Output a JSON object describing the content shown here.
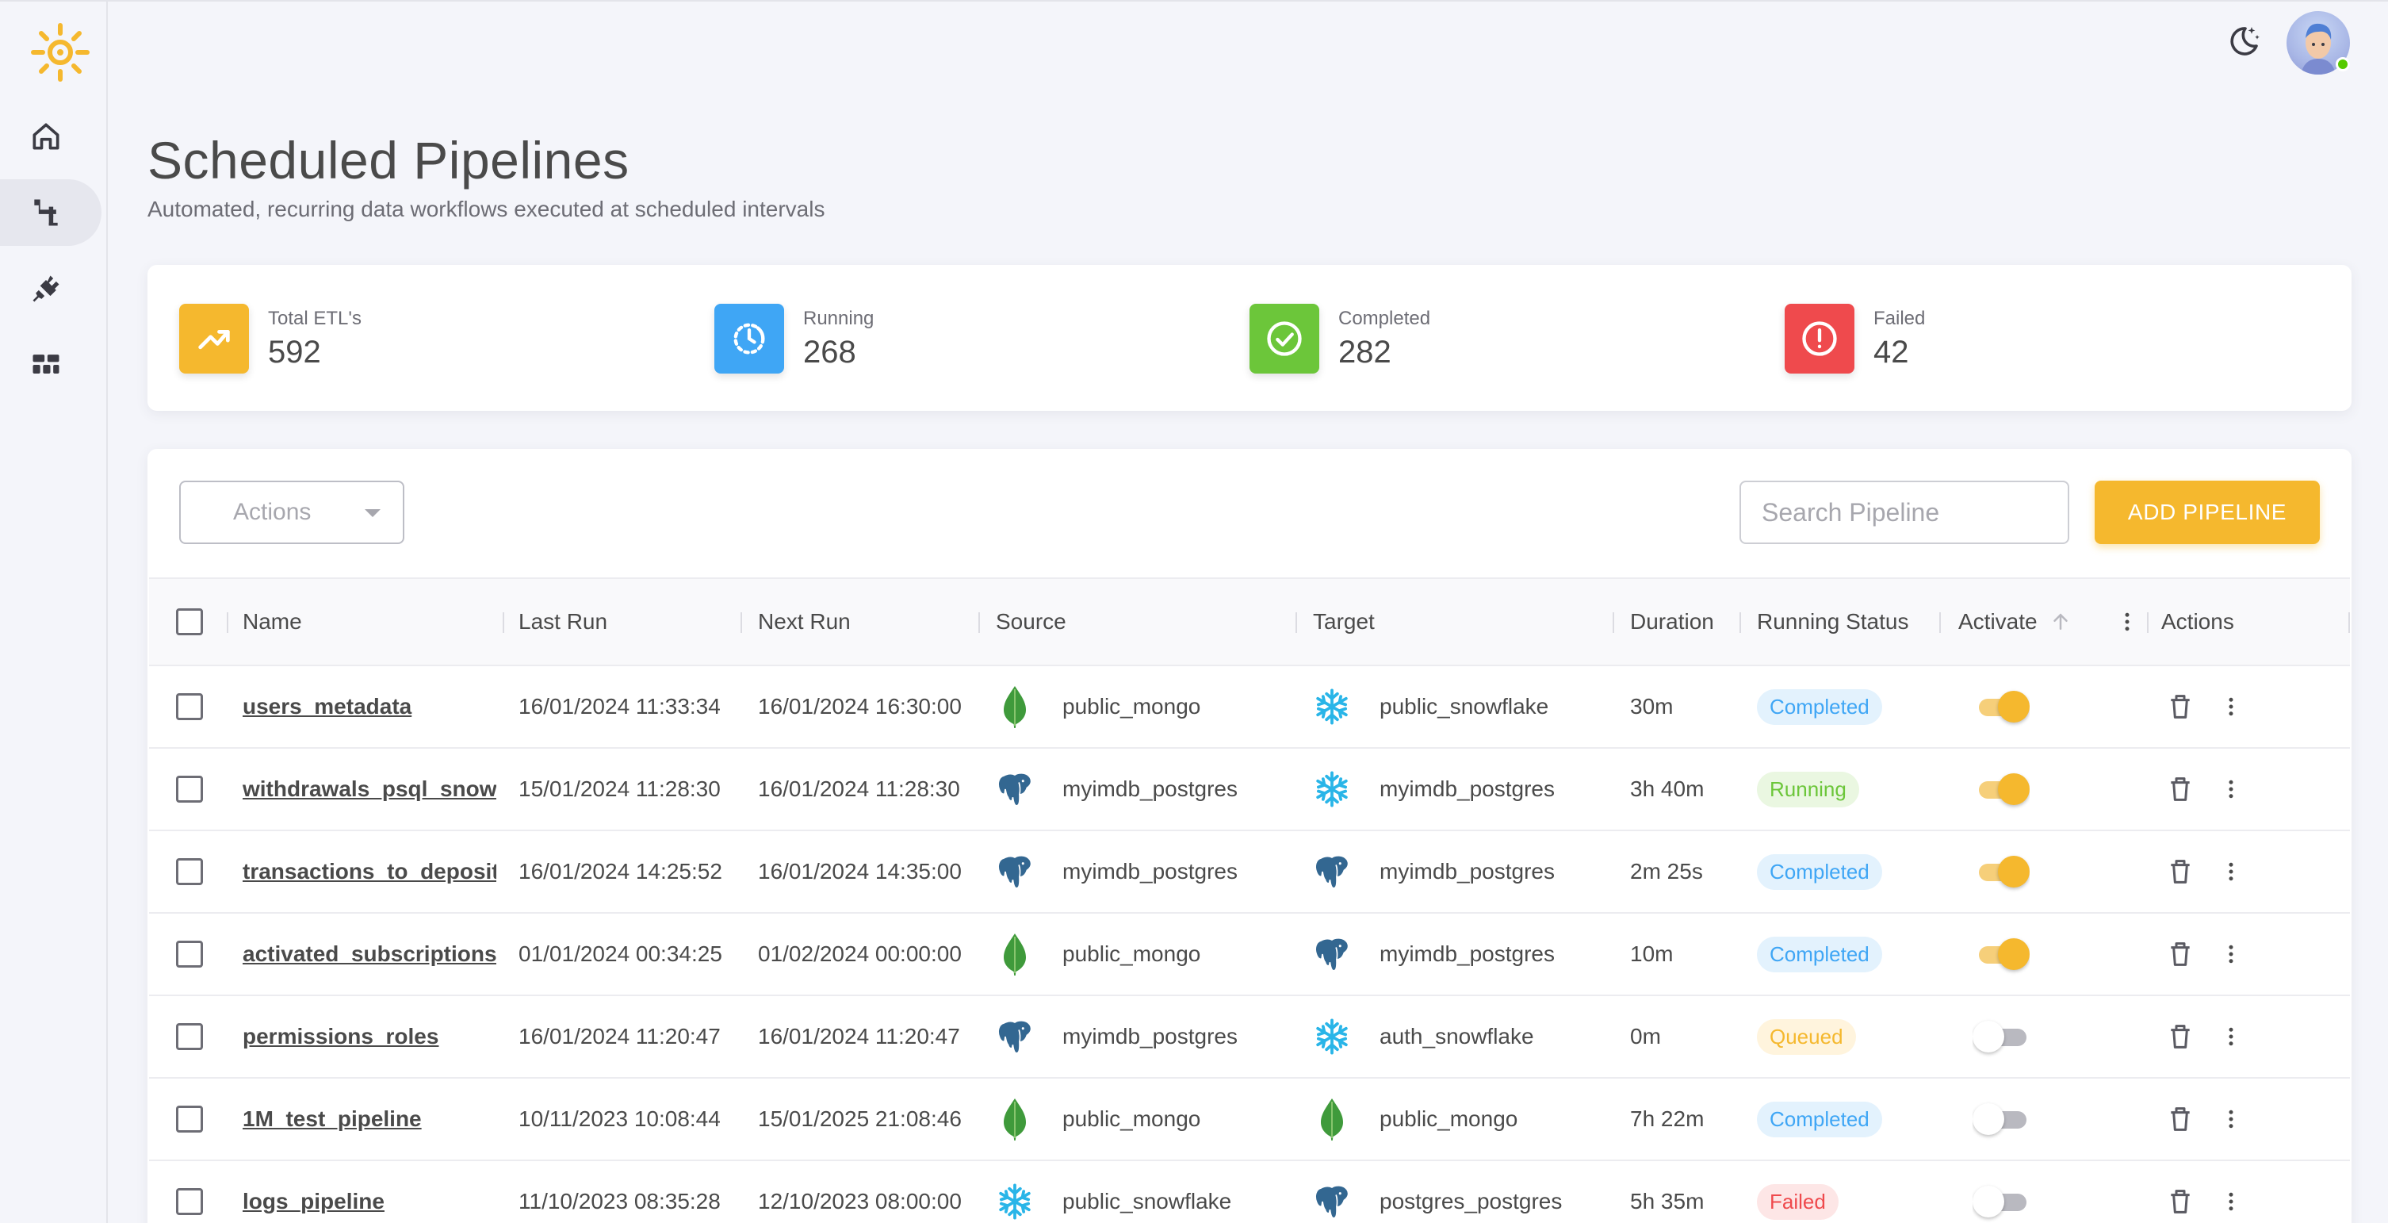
{
  "page": {
    "title": "Scheduled Pipelines",
    "subtitle": "Automated, recurring data workflows executed at scheduled intervals"
  },
  "sidebar": {
    "items": [
      {
        "name": "home",
        "icon": "home-icon"
      },
      {
        "name": "pipelines",
        "icon": "pipeline-icon",
        "active": true
      },
      {
        "name": "connections",
        "icon": "plug-icon"
      },
      {
        "name": "datasets",
        "icon": "blocks-icon"
      }
    ]
  },
  "stats": [
    {
      "label": "Total ETL's",
      "value": "592",
      "color": "#f5b82e",
      "icon": "trending-up-icon"
    },
    {
      "label": "Running",
      "value": "268",
      "color": "#3fa6f5",
      "icon": "clock-icon"
    },
    {
      "label": "Completed",
      "value": "282",
      "color": "#6cc63a",
      "icon": "check-circle-icon"
    },
    {
      "label": "Failed",
      "value": "42",
      "color": "#ef4a4d",
      "icon": "alert-circle-icon"
    }
  ],
  "toolbar": {
    "actions_label": "Actions",
    "search_placeholder": "Search Pipeline",
    "add_label": "ADD PIPELINE"
  },
  "table": {
    "columns": [
      "Name",
      "Last Run",
      "Next Run",
      "Source",
      "Target",
      "Duration",
      "Running Status",
      "Activate",
      "Actions"
    ],
    "rows": [
      {
        "name": "users_metadata",
        "last_run": "16/01/2024 11:33:34",
        "next_run": "16/01/2024 16:30:00",
        "source_type": "mongo",
        "source": "public_mongo",
        "target_type": "snowflake",
        "target": "public_snowflake",
        "duration": "30m",
        "status": "Completed",
        "active": true
      },
      {
        "name": "withdrawals_psql_snow",
        "last_run": "15/01/2024 11:28:30",
        "next_run": "16/01/2024 11:28:30",
        "source_type": "postgres",
        "source": "myimdb_postgres",
        "target_type": "snowflake",
        "target": "myimdb_postgres",
        "duration": "3h 40m",
        "status": "Running",
        "active": true
      },
      {
        "name": "transactions_to_deposit",
        "last_run": "16/01/2024 14:25:52",
        "next_run": "16/01/2024 14:35:00",
        "source_type": "postgres",
        "source": "myimdb_postgres",
        "target_type": "postgres",
        "target": "myimdb_postgres",
        "duration": "2m 25s",
        "status": "Completed",
        "active": true
      },
      {
        "name": "activated_subscriptions",
        "last_run": "01/01/2024 00:34:25",
        "next_run": "01/02/2024 00:00:00",
        "source_type": "mongo",
        "source": "public_mongo",
        "target_type": "postgres",
        "target": "myimdb_postgres",
        "duration": "10m",
        "status": "Completed",
        "active": true
      },
      {
        "name": "permissions_roles",
        "last_run": "16/01/2024 11:20:47",
        "next_run": "16/01/2024 11:20:47",
        "source_type": "postgres",
        "source": "myimdb_postgres",
        "target_type": "snowflake",
        "target": "auth_snowflake",
        "duration": "0m",
        "status": "Queued",
        "active": false
      },
      {
        "name": "1M_test_pipeline",
        "last_run": "10/11/2023 10:08:44",
        "next_run": "15/01/2025 21:08:46",
        "source_type": "mongo",
        "source": "public_mongo",
        "target_type": "mongo",
        "target": "public_mongo",
        "duration": "7h 22m",
        "status": "Completed",
        "active": false
      },
      {
        "name": "logs_pipeline",
        "last_run": "11/10/2023 08:35:28",
        "next_run": "12/10/2023 08:00:00",
        "source_type": "snowflake",
        "source": "public_snowflake",
        "target_type": "postgres",
        "target": "postgres_postgres",
        "duration": "5h 35m",
        "status": "Failed",
        "active": false
      }
    ]
  },
  "status_colors": {
    "Completed": {
      "bg": "#e3f2fd",
      "fg": "#3fa6f5"
    },
    "Running": {
      "bg": "#eaf7e1",
      "fg": "#6cc63a"
    },
    "Queued": {
      "bg": "#fff4dd",
      "fg": "#f5b82e"
    },
    "Failed": {
      "bg": "#fde6e6",
      "fg": "#ef4a4d"
    }
  },
  "colors": {
    "accent": "#f5b82e",
    "toggle_on": "#f5b82e",
    "toggle_off": "#b9b9c0"
  }
}
